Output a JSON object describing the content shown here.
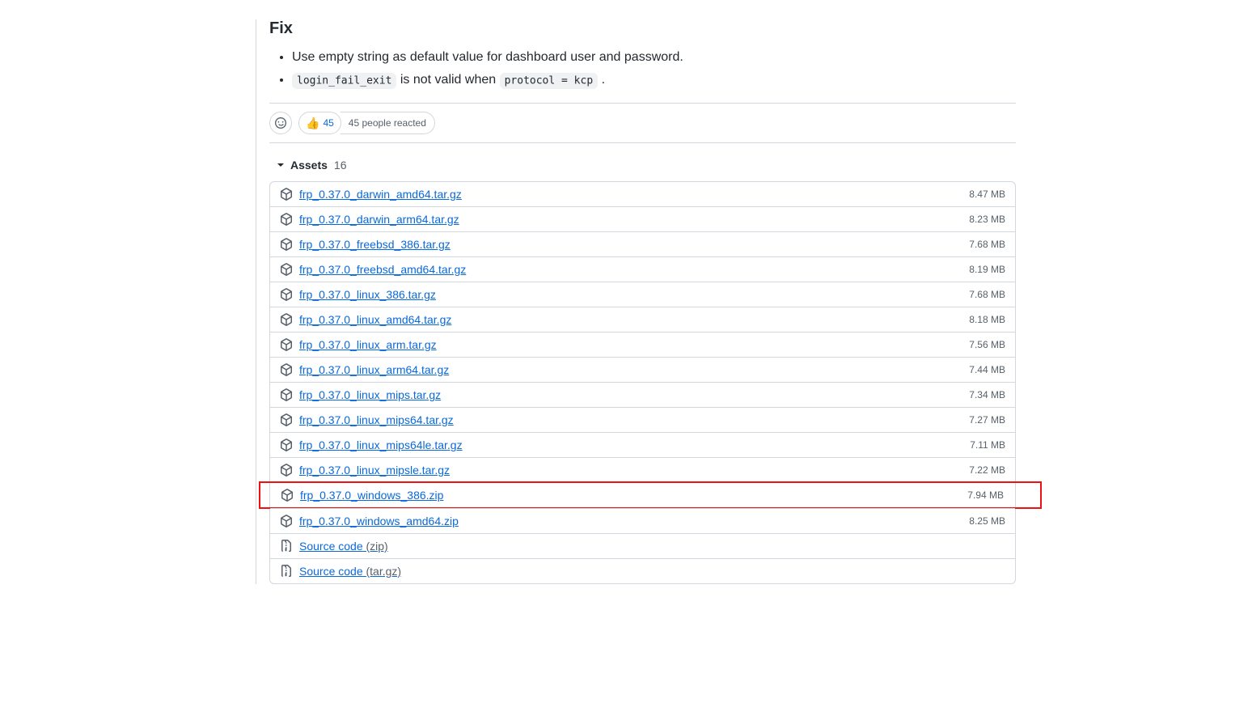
{
  "fix": {
    "heading": "Fix",
    "items": [
      {
        "pre": "Use empty string as default value for dashboard user and password."
      },
      {
        "code1": "login_fail_exit",
        "mid": " is not valid when ",
        "code2": "protocol = kcp",
        "post": " ."
      }
    ]
  },
  "reactions": {
    "thumbs_emoji": "👍",
    "thumbs_count": "45",
    "reacted_text": "45 people reacted"
  },
  "assets": {
    "label": "Assets",
    "count": "16",
    "list": [
      {
        "name": "frp_0.37.0_darwin_amd64.tar.gz",
        "size": "8.47 MB",
        "type": "pkg",
        "hl": false
      },
      {
        "name": "frp_0.37.0_darwin_arm64.tar.gz",
        "size": "8.23 MB",
        "type": "pkg",
        "hl": false
      },
      {
        "name": "frp_0.37.0_freebsd_386.tar.gz",
        "size": "7.68 MB",
        "type": "pkg",
        "hl": false
      },
      {
        "name": "frp_0.37.0_freebsd_amd64.tar.gz",
        "size": "8.19 MB",
        "type": "pkg",
        "hl": false
      },
      {
        "name": "frp_0.37.0_linux_386.tar.gz",
        "size": "7.68 MB",
        "type": "pkg",
        "hl": false
      },
      {
        "name": "frp_0.37.0_linux_amd64.tar.gz",
        "size": "8.18 MB",
        "type": "pkg",
        "hl": false
      },
      {
        "name": "frp_0.37.0_linux_arm.tar.gz",
        "size": "7.56 MB",
        "type": "pkg",
        "hl": false
      },
      {
        "name": "frp_0.37.0_linux_arm64.tar.gz",
        "size": "7.44 MB",
        "type": "pkg",
        "hl": false
      },
      {
        "name": "frp_0.37.0_linux_mips.tar.gz",
        "size": "7.34 MB",
        "type": "pkg",
        "hl": false
      },
      {
        "name": "frp_0.37.0_linux_mips64.tar.gz",
        "size": "7.27 MB",
        "type": "pkg",
        "hl": false
      },
      {
        "name": "frp_0.37.0_linux_mips64le.tar.gz",
        "size": "7.11 MB",
        "type": "pkg",
        "hl": false
      },
      {
        "name": "frp_0.37.0_linux_mipsle.tar.gz",
        "size": "7.22 MB",
        "type": "pkg",
        "hl": false
      },
      {
        "name": "frp_0.37.0_windows_386.zip",
        "size": "7.94 MB",
        "type": "pkg",
        "hl": true
      },
      {
        "name": "frp_0.37.0_windows_amd64.zip",
        "size": "8.25 MB",
        "type": "pkg",
        "hl": false
      },
      {
        "name": "Source code",
        "ext": "(zip)",
        "size": "",
        "type": "src",
        "hl": false
      },
      {
        "name": "Source code",
        "ext": "(tar.gz)",
        "size": "",
        "type": "src",
        "hl": false
      }
    ]
  }
}
